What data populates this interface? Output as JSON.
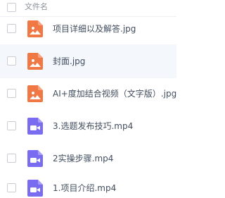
{
  "header": {
    "column_name": "文件名"
  },
  "colors": {
    "image_icon": "#f07844",
    "video_icon": "#7a6cf0",
    "selected_row_bg": "#f4f8fc"
  },
  "files": [
    {
      "name": "项目详细以及解答.jpg",
      "type": "image-icon"
    },
    {
      "name": "封面.jpg",
      "type": "image-icon",
      "highlighted": true
    },
    {
      "name": "AI+度加结合视频（文字版）.jpg",
      "type": "image-icon"
    },
    {
      "name": "3.选题发布技巧.mp4",
      "type": "video-icon"
    },
    {
      "name": "2实操步骤.mp4",
      "type": "video-icon"
    },
    {
      "name": "1.项目介绍.mp4",
      "type": "video-icon"
    }
  ]
}
